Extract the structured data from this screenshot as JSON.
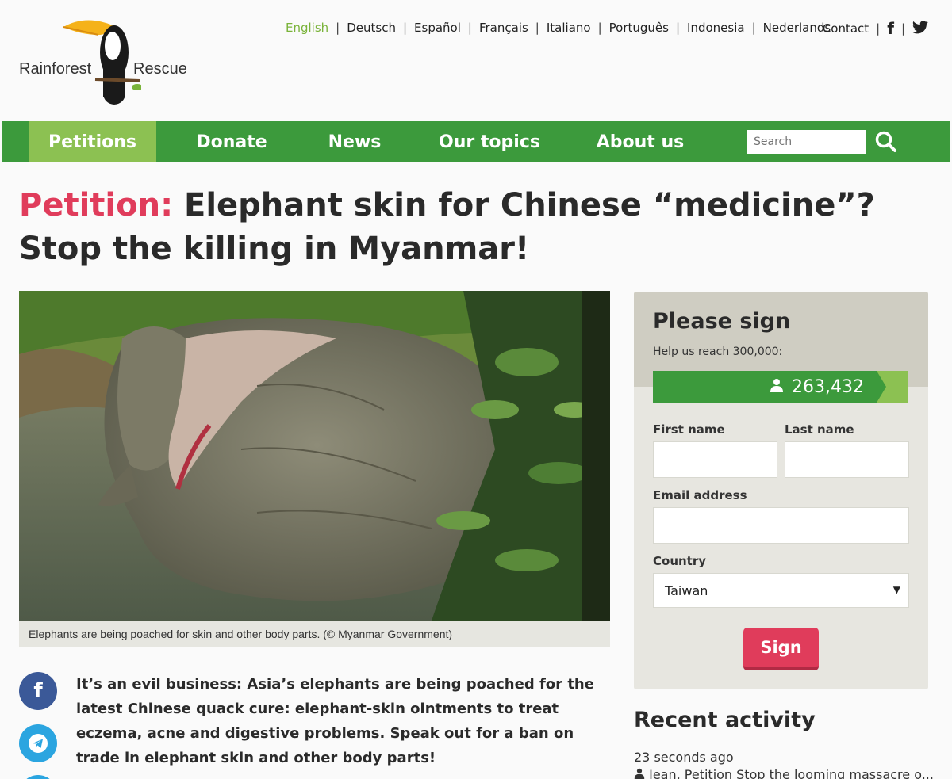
{
  "header": {
    "logo_left": "Rainforest",
    "logo_right": "Rescue",
    "languages": [
      "English",
      "Deutsch",
      "Español",
      "Français",
      "Italiano",
      "Português",
      "Indonesia",
      "Nederlands"
    ],
    "active_language": "English",
    "contact": "Contact",
    "facebook_icon": "facebook-icon",
    "twitter_icon": "twitter-icon"
  },
  "nav": {
    "items": [
      "Petitions",
      "Donate",
      "News",
      "Our topics",
      "About us"
    ],
    "active": "Petitions",
    "search_placeholder": "Search"
  },
  "title": {
    "prefix": "Petition:",
    "text": "Elephant skin for Chinese “medicine”? Stop the killing in Myanmar!"
  },
  "hero": {
    "caption": "Elephants are being poached for skin and other body parts. (© Myanmar Government)"
  },
  "intro": "It’s an evil business: Asia’s elephants are being poached for the latest Chinese quack cure: elephant-skin ointments to treat eczema, acne and digestive problems. Speak out for a ban on trade in elephant skin and other body parts!",
  "sign_panel": {
    "heading": "Please sign",
    "goal": "Help us reach 300,000:",
    "count": "263,432",
    "progress": 0.878,
    "first_name_label": "First name",
    "last_name_label": "Last name",
    "email_label": "Email address",
    "country_label": "Country",
    "country_value": "Taiwan",
    "sign_label": "Sign"
  },
  "recent": {
    "heading": "Recent activity",
    "time": "23 seconds ago",
    "entry": "Jean, Petition Stop the looming massacre o..."
  },
  "colors": {
    "green": "#3c9a3c",
    "light_green": "#8cc152",
    "accent_red": "#e03c5b",
    "facebook_blue": "#3b5998",
    "telegram_blue": "#2ba5e0"
  }
}
